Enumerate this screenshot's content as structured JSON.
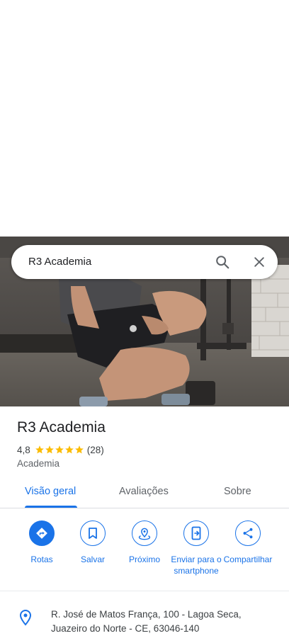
{
  "search": {
    "value": "R3 Academia"
  },
  "place": {
    "name": "R3 Academia",
    "rating": "4,8",
    "stars": 5,
    "review_count": "(28)",
    "category": "Academia"
  },
  "tabs": [
    {
      "label": "Visão geral",
      "active": true
    },
    {
      "label": "Avaliações",
      "active": false
    },
    {
      "label": "Sobre",
      "active": false
    }
  ],
  "actions": [
    {
      "label": "Rotas",
      "icon": "directions-icon"
    },
    {
      "label": "Salvar",
      "icon": "bookmark-icon"
    },
    {
      "label": "Próximo",
      "icon": "nearby-icon"
    },
    {
      "label": "Enviar para o smartphone",
      "icon": "send-to-phone-icon"
    },
    {
      "label": "Compartilhar",
      "icon": "share-icon"
    }
  ],
  "address": {
    "text": "R. José de Matos França, 100 - Lagoa Seca, Juazeiro do Norte - CE, 63046-140"
  },
  "colors": {
    "accent": "#1a73e8",
    "star": "#fbbc04",
    "text": "#202124",
    "secondary": "#5f6368"
  }
}
